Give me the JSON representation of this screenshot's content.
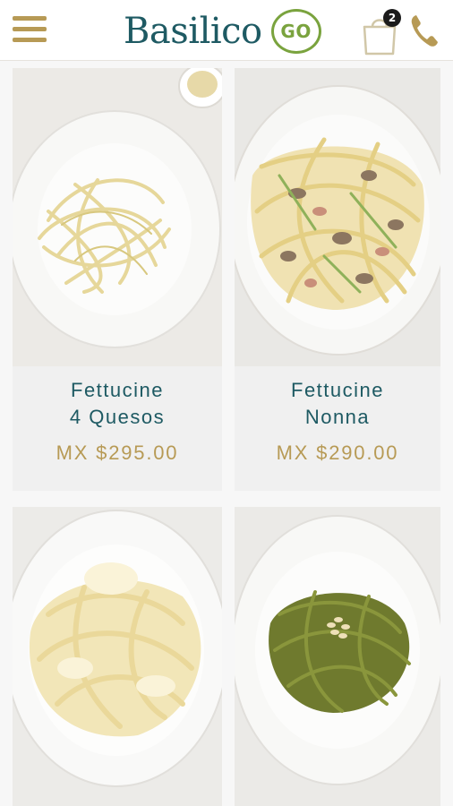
{
  "header": {
    "brand": "Basilico",
    "brand_badge": "GO",
    "cart_count": "2",
    "icons": [
      "menu-icon",
      "shopping-bag-icon",
      "phone-icon"
    ],
    "colors": {
      "brand": "#1e5a63",
      "accent": "#b79a55",
      "go": "#7aa33e"
    }
  },
  "products": [
    {
      "title_line1": "Fettucine",
      "title_line2": "4 Quesos",
      "price": "MX $295.00",
      "dish": "white-pasta-plate"
    },
    {
      "title_line1": "Fettucine",
      "title_line2": "Nonna",
      "price": "MX $290.00",
      "dish": "creamy-mushroom-pasta-plate"
    },
    {
      "dish": "alfredo-pasta-plate"
    },
    {
      "dish": "pesto-pasta-plate"
    }
  ]
}
